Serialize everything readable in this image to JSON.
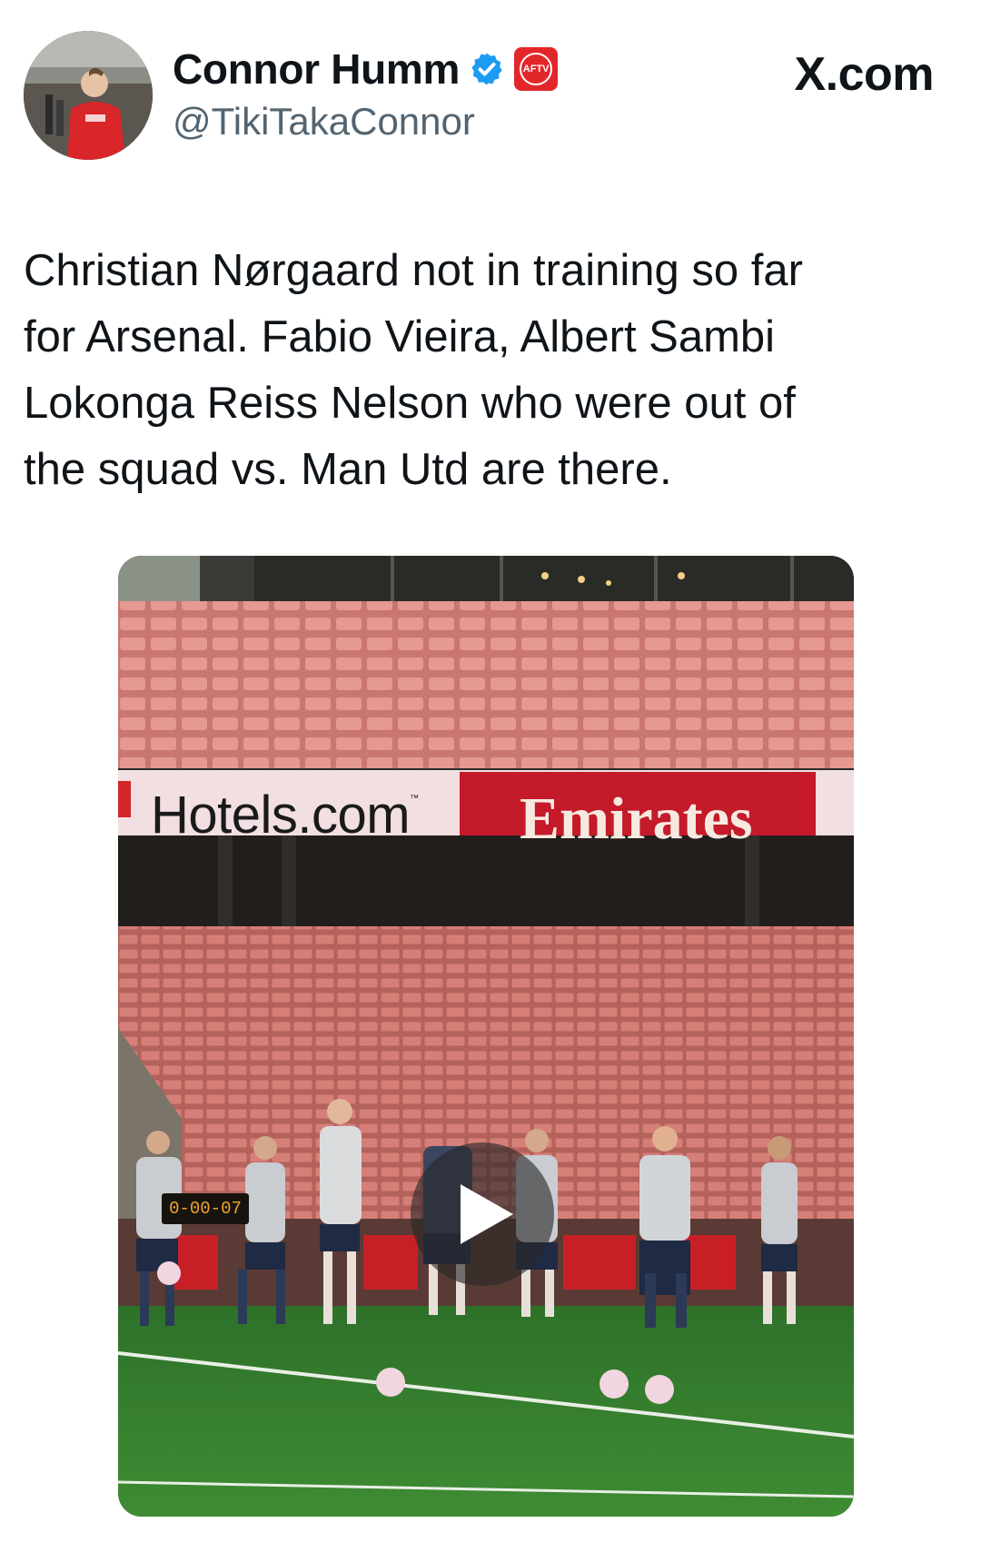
{
  "author": {
    "display_name": "Connor Humm",
    "handle": "@TikiTakaConnor",
    "verified": true,
    "affiliate_badge": "AFTV"
  },
  "source_site": "X.com",
  "tweet": {
    "text": "Christian Nørgaard not in training so far\nfor Arsenal. Fabio Vieira, Albert Sambi\nLokonga Reiss Nelson who were out of\nthe squad vs. Man Utd are there."
  },
  "media": {
    "type": "video",
    "thumbnail_signage": {
      "hotels": "Hotels.com",
      "emirates": "Emirates",
      "scoreboard": "0-00-07"
    }
  },
  "colors": {
    "verified": "#1d9bf0",
    "badge": "#e2272b",
    "pitch": "#2f7a2c",
    "seats": "#d9827c"
  },
  "icons": [
    "verified-icon",
    "play-icon"
  ]
}
